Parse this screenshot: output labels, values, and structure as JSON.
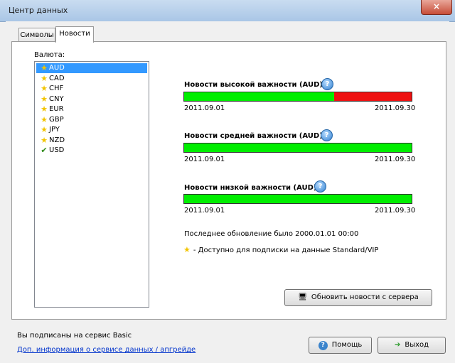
{
  "window": {
    "title": "Центр данных",
    "close_label": "×"
  },
  "tabs": [
    {
      "label": "Символы",
      "active": false
    },
    {
      "label": "Новости",
      "active": true
    }
  ],
  "currency_label": "Валюта:",
  "currencies": [
    {
      "code": "AUD",
      "icon": "star-icon",
      "selected": true
    },
    {
      "code": "CAD",
      "icon": "star-icon",
      "selected": false
    },
    {
      "code": "CHF",
      "icon": "star-icon",
      "selected": false
    },
    {
      "code": "CNY",
      "icon": "star-icon",
      "selected": false
    },
    {
      "code": "EUR",
      "icon": "star-icon",
      "selected": false
    },
    {
      "code": "GBP",
      "icon": "star-icon",
      "selected": false
    },
    {
      "code": "JPY",
      "icon": "star-icon",
      "selected": false
    },
    {
      "code": "NZD",
      "icon": "star-icon",
      "selected": false
    },
    {
      "code": "USD",
      "icon": "check-icon",
      "selected": false
    }
  ],
  "news": [
    {
      "title": "Новости высокой важности (AUD):",
      "start": "2011.09.01",
      "end": "2011.09.30",
      "green_fraction": 0.66
    },
    {
      "title": "Новости средней важности (AUD):",
      "start": "2011.09.01",
      "end": "2011.09.30",
      "green_fraction": 1.0
    },
    {
      "title": "Новости низкой важности (AUD):",
      "start": "2011.09.01",
      "end": "2011.09.30",
      "green_fraction": 1.0
    }
  ],
  "last_update": "Последнее обновление было 2000.01.01 00:00",
  "legend_text": "- Доступно для подписки на данные Standard/VIP",
  "refresh_button": "Обновить новости с сервера",
  "subscribed_text": "Вы подписаны на сервис Basic",
  "info_link": "Доп. информация о сервисе данных / апгрейде",
  "help_button": "Помощь",
  "exit_button": "Выход",
  "colors": {
    "bar_green": "#00ee00",
    "bar_red": "#ee1111",
    "selection": "#3399ff"
  }
}
